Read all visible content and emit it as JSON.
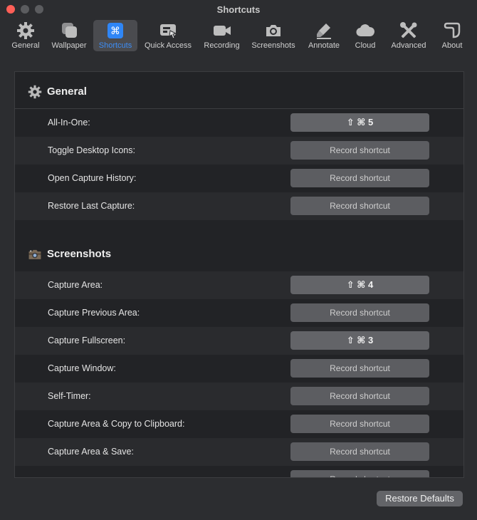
{
  "window": {
    "title": "Shortcuts"
  },
  "toolbar": {
    "tabs": [
      {
        "label": "General",
        "icon": "gear-icon"
      },
      {
        "label": "Wallpaper",
        "icon": "wallpaper-icon"
      },
      {
        "label": "Shortcuts",
        "icon": "command-icon",
        "selected": true
      },
      {
        "label": "Quick Access",
        "icon": "quick-access-icon"
      },
      {
        "label": "Recording",
        "icon": "video-camera-icon"
      },
      {
        "label": "Screenshots",
        "icon": "camera-icon"
      },
      {
        "label": "Annotate",
        "icon": "highlighter-icon"
      },
      {
        "label": "Cloud",
        "icon": "cloud-icon"
      },
      {
        "label": "Advanced",
        "icon": "tools-icon"
      },
      {
        "label": "About",
        "icon": "about-icon"
      }
    ]
  },
  "sections": {
    "general": {
      "title": "General",
      "icon": "gear-icon",
      "rows": [
        {
          "label": "All-In-One:",
          "shortcut": "⇧ ⌘ 5"
        },
        {
          "label": "Toggle Desktop Icons:",
          "shortcut": "Record shortcut"
        },
        {
          "label": "Open Capture History:",
          "shortcut": "Record shortcut"
        },
        {
          "label": "Restore Last Capture:",
          "shortcut": "Record shortcut"
        }
      ]
    },
    "screenshots": {
      "title": "Screenshots",
      "icon": "camera-icon",
      "rows": [
        {
          "label": "Capture Area:",
          "shortcut": "⇧ ⌘ 4"
        },
        {
          "label": "Capture Previous Area:",
          "shortcut": "Record shortcut"
        },
        {
          "label": "Capture Fullscreen:",
          "shortcut": "⇧ ⌘ 3"
        },
        {
          "label": "Capture Window:",
          "shortcut": "Record shortcut"
        },
        {
          "label": "Self-Timer:",
          "shortcut": "Record shortcut"
        },
        {
          "label": "Capture Area & Copy to Clipboard:",
          "shortcut": "Record shortcut"
        },
        {
          "label": "Capture Area & Save:",
          "shortcut": "Record shortcut"
        },
        {
          "label": "",
          "shortcut": "Record shortcut"
        }
      ]
    }
  },
  "footer": {
    "restore_label": "Restore Defaults"
  },
  "colors": {
    "accent": "#3d8ef7",
    "close": "#ff5f57",
    "panel": "#222326",
    "button": "#5c5d61"
  }
}
